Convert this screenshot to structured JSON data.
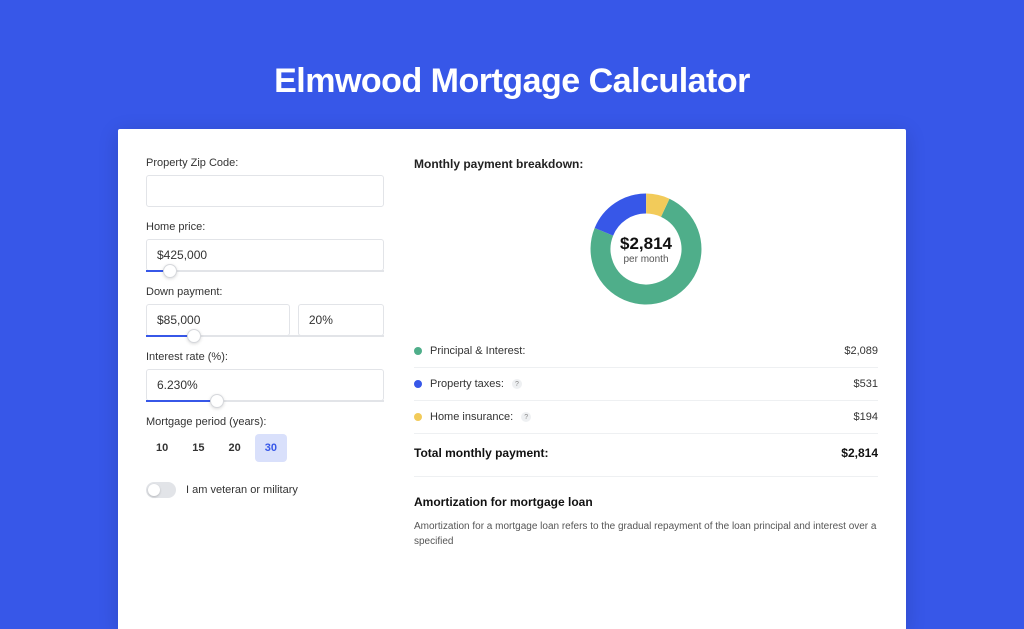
{
  "title": "Elmwood Mortgage Calculator",
  "form": {
    "zip_label": "Property Zip Code:",
    "zip_value": "",
    "home_price_label": "Home price:",
    "home_price_value": "$425,000",
    "home_price_slider_pct": 10,
    "down_payment_label": "Down payment:",
    "down_payment_amount": "$85,000",
    "down_payment_pct": "20%",
    "down_payment_slider_pct": 20,
    "interest_label": "Interest rate (%):",
    "interest_value": "6.230%",
    "interest_slider_pct": 30,
    "period_label": "Mortgage period (years):",
    "periods": [
      "10",
      "15",
      "20",
      "30"
    ],
    "period_selected_index": 3,
    "toggle_on": false,
    "toggle_label": "I am veteran or military"
  },
  "breakdown": {
    "title": "Monthly payment breakdown:",
    "center_amount": "$2,814",
    "center_sub": "per month",
    "items": [
      {
        "label": "Principal & Interest:",
        "value": "$2,089",
        "color": "#4fae8a",
        "help": false,
        "numeric": 2089
      },
      {
        "label": "Property taxes:",
        "value": "$531",
        "color": "#3757e8",
        "help": true,
        "numeric": 531
      },
      {
        "label": "Home insurance:",
        "value": "$194",
        "color": "#f2cb5a",
        "help": true,
        "numeric": 194
      }
    ],
    "total_label": "Total monthly payment:",
    "total_value": "$2,814"
  },
  "amortization": {
    "title": "Amortization for mortgage loan",
    "text": "Amortization for a mortgage loan refers to the gradual repayment of the loan principal and interest over a specified"
  },
  "chart_data": {
    "type": "pie",
    "title": "Monthly payment breakdown",
    "series": [
      {
        "name": "Principal & Interest",
        "value": 2089,
        "color": "#4fae8a"
      },
      {
        "name": "Property taxes",
        "value": 531,
        "color": "#3757e8"
      },
      {
        "name": "Home insurance",
        "value": 194,
        "color": "#f2cb5a"
      }
    ],
    "total": 2814,
    "unit": "USD per month"
  }
}
